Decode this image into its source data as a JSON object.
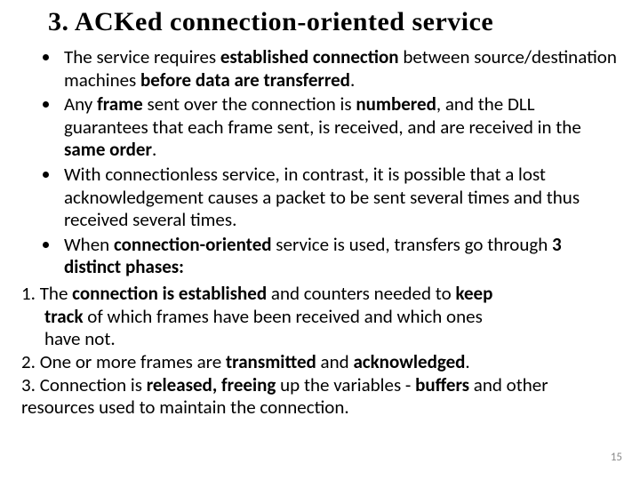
{
  "title": "3. ACKed connection-oriented service",
  "bullets": [
    "The service requires <b>established</b> <b>connection</b> between source/destination machines <b>before</b> <b>data</b> <b>are</b> <b>transferred</b>.",
    "Any <b>frame</b> sent over the connection is <b>numbered</b>, and the DLL guarantees that each frame sent, is received, and are received in the <b>same</b> <b>order</b>.",
    "With connectionless service, in contrast, it is possible that a lost acknowledgement causes a packet to be sent several times and thus received several times.",
    "When <b>connection-oriented</b> service is used, transfers go through <b>3 distinct phases:</b>"
  ],
  "phases": [
    "1. The <b>connection is established</b> and counters needed to <b>keep</b><span class=\"indent\"><b>track</b> of which frames have been received and which ones</span><span class=\"indent\">have not.</span>",
    "2. One or more frames are <b>transmitted</b> and <b>acknowledged</b>.",
    "3. Connection is <b>released,</b> <b>freeing</b> up the variables - <b>buffers</b> and other resources used to maintain the connection."
  ],
  "pageNumber": "15"
}
